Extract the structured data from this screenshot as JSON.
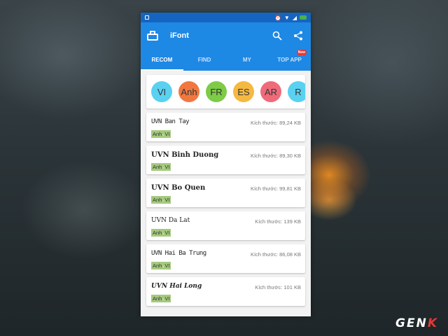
{
  "app": {
    "title": "iFont"
  },
  "tabs": [
    {
      "label": "RECOM",
      "active": true
    },
    {
      "label": "FIND",
      "active": false
    },
    {
      "label": "MY",
      "active": false
    },
    {
      "label": "TOP APP",
      "active": false,
      "badge": "New"
    }
  ],
  "languages": [
    {
      "code": "VI",
      "color": "#5ad1f0"
    },
    {
      "code": "Anh",
      "color": "#f07840"
    },
    {
      "code": "FR",
      "color": "#7ecb47"
    },
    {
      "code": "ES",
      "color": "#f5b841"
    },
    {
      "code": "AR",
      "color": "#ef6b7a"
    },
    {
      "code": "R",
      "color": "#5ad1f0"
    }
  ],
  "fonts": [
    {
      "name": "UVN Ban Tay",
      "size": "Kích thước: 89,24 KB",
      "tags": [
        "Anh",
        "VI"
      ]
    },
    {
      "name": "UVN Binh Duong",
      "size": "Kích thước: 89,30 KB",
      "tags": [
        "Anh",
        "VI"
      ]
    },
    {
      "name": "UVN Bo Quen",
      "size": "Kích thước: 99,81 KB",
      "tags": [
        "Anh",
        "VI"
      ]
    },
    {
      "name": "UVN Da Lat",
      "size": "Kích thước: 139 KB",
      "tags": [
        "Anh",
        "VI"
      ]
    },
    {
      "name": "UVN Hai Ba Trung",
      "size": "Kích thước: 86,08 KB",
      "tags": [
        "Anh",
        "VI"
      ]
    },
    {
      "name": "UVN Hai Long",
      "size": "Kích thước: 101 KB",
      "tags": [
        "Anh",
        "VI"
      ]
    }
  ],
  "watermark": {
    "text_main": "GEN",
    "text_accent": "K"
  },
  "icons": {
    "app": "toolbox-icon",
    "search": "search-icon",
    "share": "share-icon"
  },
  "colors": {
    "primary": "#1e88e5",
    "status_bar": "#1565c0",
    "tag_bg": "#a5c97e"
  }
}
